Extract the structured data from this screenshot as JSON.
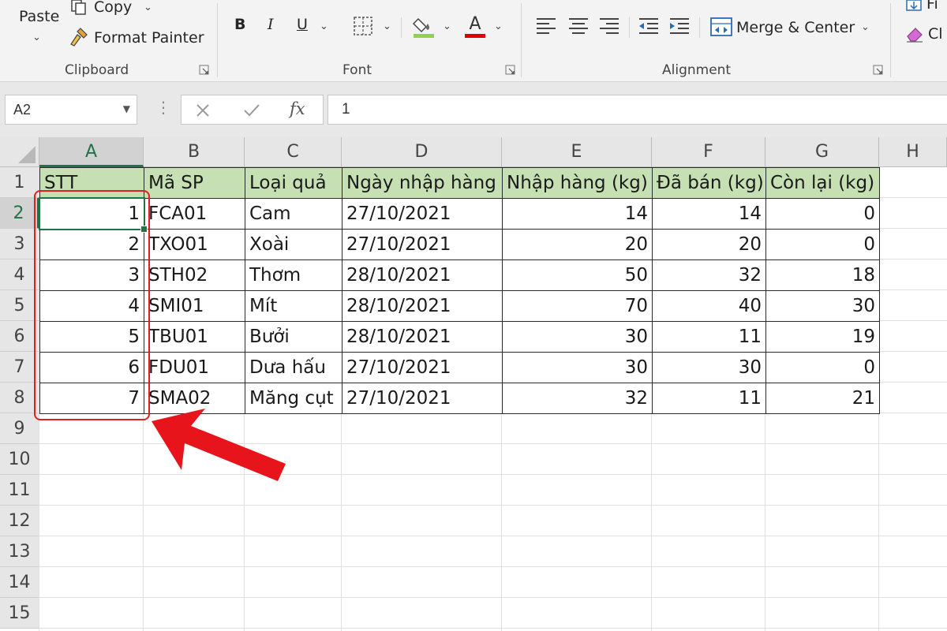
{
  "ribbon": {
    "clipboard": {
      "paste": "Paste",
      "copy": "Copy",
      "format_painter": "Format Painter",
      "group_label": "Clipboard"
    },
    "font": {
      "bold": "B",
      "italic": "I",
      "underline": "U",
      "font_color": "A",
      "group_label": "Font"
    },
    "alignment": {
      "merge_center": "Merge & Center",
      "group_label": "Alignment"
    },
    "right_cut": {
      "top": "Fi",
      "bottom": "Cl"
    }
  },
  "formula_bar": {
    "name_box": "A2",
    "fx": "fx",
    "value": "1"
  },
  "grid": {
    "columns": [
      "A",
      "B",
      "C",
      "D",
      "E",
      "F",
      "G",
      "H"
    ],
    "rows": [
      "1",
      "2",
      "3",
      "4",
      "5",
      "6",
      "7",
      "8",
      "9",
      "10",
      "11",
      "12",
      "13",
      "14",
      "15"
    ],
    "headers": [
      "STT",
      "Mã SP",
      "Loại quả",
      "Ngày nhập hàng",
      "Nhập hàng (kg)",
      "Đã bán (kg)",
      "Còn lại (kg)"
    ],
    "data": [
      [
        "1",
        "FCA01",
        "Cam",
        "27/10/2021",
        "14",
        "14",
        "0"
      ],
      [
        "2",
        "TXO01",
        "Xoài",
        "27/10/2021",
        "20",
        "20",
        "0"
      ],
      [
        "3",
        "STH02",
        "Thơm",
        "28/10/2021",
        "50",
        "32",
        "18"
      ],
      [
        "4",
        "SMI01",
        "Mít",
        "28/10/2021",
        "70",
        "40",
        "30"
      ],
      [
        "5",
        "TBU01",
        "Bưởi",
        "28/10/2021",
        "30",
        "11",
        "19"
      ],
      [
        "6",
        "FDU01",
        "Dưa hấu",
        "27/10/2021",
        "30",
        "30",
        "0"
      ],
      [
        "7",
        "SMA02",
        "Măng cụt",
        "27/10/2021",
        "32",
        "11",
        "21"
      ]
    ],
    "active_cell": "A2"
  },
  "colors": {
    "header_fill": "#c6e0b4",
    "accent": "#217346",
    "annotation": "#e02020"
  }
}
